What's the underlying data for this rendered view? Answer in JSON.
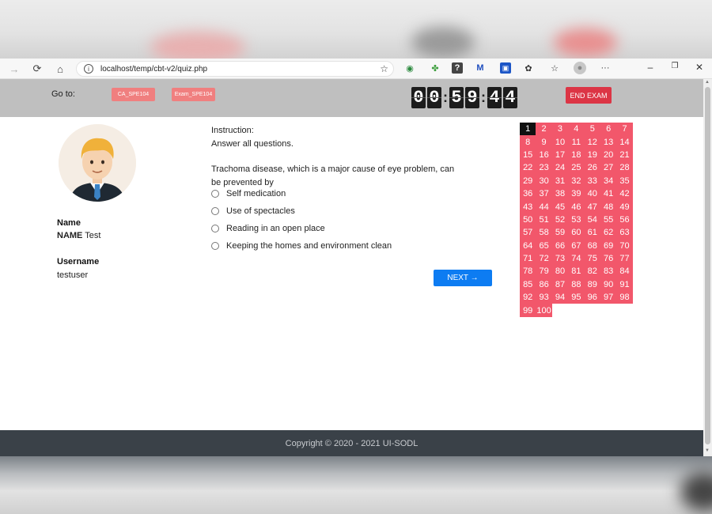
{
  "browser": {
    "url": "localhost/temp/cbt-v2/quiz.php"
  },
  "header": {
    "goto_label": "Go to:",
    "goto_buttons": [
      "CA_SPE104",
      "Exam_SPE104"
    ],
    "timer": {
      "hours": "00",
      "minutes": "59",
      "seconds": "44"
    },
    "end_exam_label": "END EXAM"
  },
  "profile": {
    "name_heading": "Name",
    "name_prefix": "NAME",
    "name_value": "Test",
    "username_heading": "Username",
    "username_value": "testuser"
  },
  "question": {
    "instruction_label": "Instruction:",
    "instruction_text": "Answer all questions.",
    "text": "Trachoma disease, which is a major cause of eye problem, can be prevented by",
    "options": [
      "Self medication",
      "Use of spectacles",
      "Reading in an open place",
      "Keeping the homes and environment clean"
    ],
    "next_label": "NEXT →"
  },
  "question_grid": {
    "total": 100,
    "current": 1
  },
  "footer": {
    "copyright": "Copyright © 2020 - 2021 UI-SODL"
  },
  "colors": {
    "grid_cell": "#f2576b",
    "current_cell": "#111111",
    "end_exam": "#dc3545",
    "next": "#0d7cf2",
    "goto_button": "#f07f7f",
    "footer": "#3a4148"
  }
}
